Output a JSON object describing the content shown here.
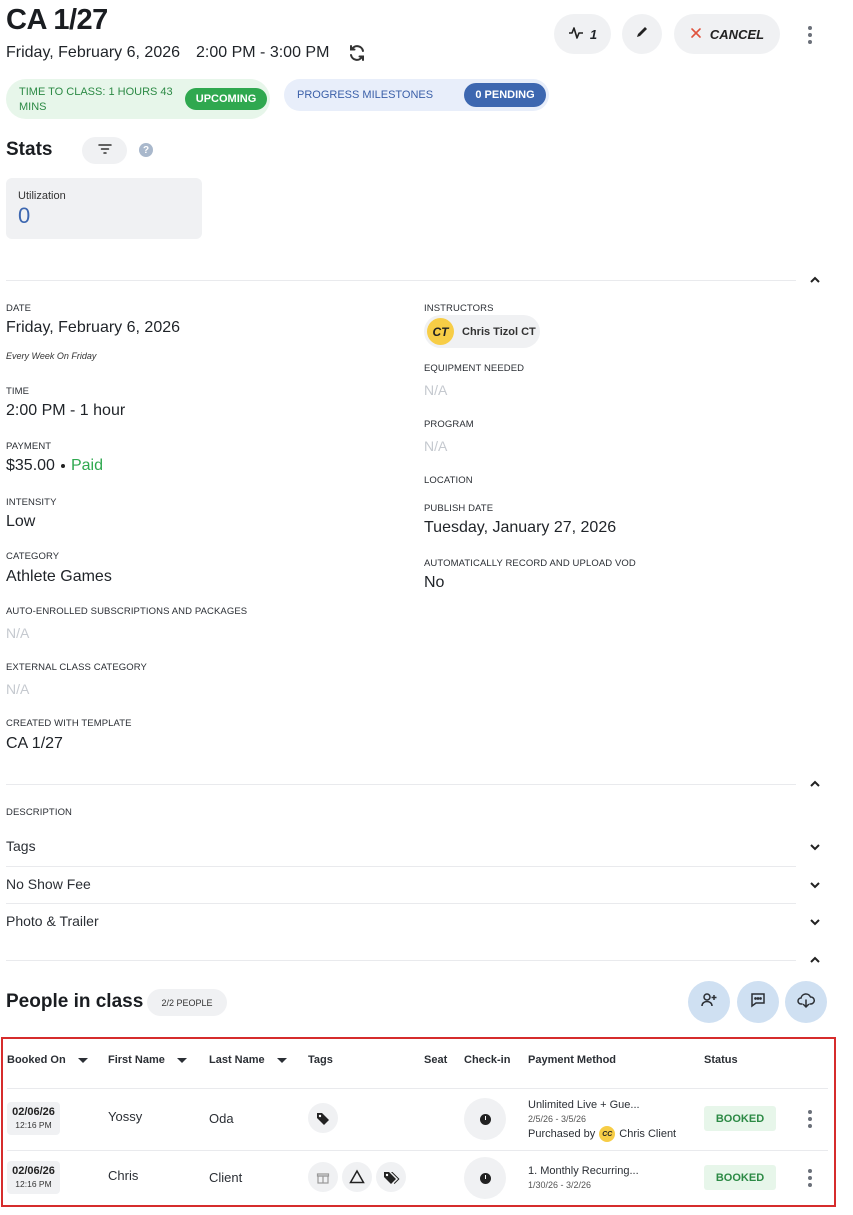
{
  "header": {
    "title": "CA 1/27",
    "date": "Friday, February 6, 2026",
    "time": "2:00 PM - 3:00 PM",
    "activity_count": "1",
    "cancel_label": "CANCEL"
  },
  "status": {
    "time_to_class": "TIME TO CLASS: 1 HOURS 43 MINS",
    "time_badge": "UPCOMING",
    "milestones_label": "PROGRESS MILESTONES",
    "milestones_badge": "0 PENDING"
  },
  "stats": {
    "title": "Stats",
    "help": "?",
    "utilization_label": "Utilization",
    "utilization_value": "0"
  },
  "details": {
    "date_label": "DATE",
    "date_value": "Friday, February 6, 2026",
    "recurrence": "Every Week On Friday",
    "time_label": "TIME",
    "time_value": "2:00 PM - 1 hour",
    "payment_label": "PAYMENT",
    "payment_amount": "$35.00",
    "payment_status": "Paid",
    "intensity_label": "INTENSITY",
    "intensity_value": "Low",
    "category_label": "CATEGORY",
    "category_value": "Athlete Games",
    "auto_enrolled_label": "AUTO-ENROLLED SUBSCRIPTIONS AND PACKAGES",
    "auto_enrolled_value": "N/A",
    "external_category_label": "EXTERNAL CLASS CATEGORY",
    "external_category_value": "N/A",
    "template_label": "CREATED WITH TEMPLATE",
    "template_value": "CA 1/27",
    "instructors_label": "INSTRUCTORS",
    "instructor_initials": "CT",
    "instructor_name": "Chris Tizol CT",
    "equipment_label": "EQUIPMENT NEEDED",
    "equipment_value": "N/A",
    "program_label": "PROGRAM",
    "program_value": "N/A",
    "location_label": "LOCATION",
    "publish_label": "PUBLISH DATE",
    "publish_value": "Tuesday, January 27, 2026",
    "vod_label": "AUTOMATICALLY RECORD AND UPLOAD VOD",
    "vod_value": "No"
  },
  "sections": {
    "description_label": "DESCRIPTION",
    "tags": "Tags",
    "no_show_fee": "No Show Fee",
    "photo_trailer": "Photo & Trailer"
  },
  "people": {
    "title": "People in class",
    "count_badge": "2/2 PEOPLE",
    "columns": [
      "Booked On",
      "First Name",
      "Last Name",
      "Tags",
      "Seat",
      "Check-in",
      "Payment Method",
      "Status"
    ],
    "rows": [
      {
        "date": "02/06/26",
        "time": "12:16 PM",
        "first": "Yossy",
        "last": "Oda",
        "payment_name": "Unlimited Live + Gue...",
        "payment_range": "2/5/26 - 3/5/26",
        "purchased_prefix": "Purchased by",
        "purchaser_initials": "CC",
        "purchaser_name": "Chris Client",
        "status": "BOOKED"
      },
      {
        "date": "02/06/26",
        "time": "12:16 PM",
        "first": "Chris",
        "last": "Client",
        "payment_name": "1. Monthly Recurring...",
        "payment_range": "1/30/26 - 3/2/26",
        "status": "BOOKED"
      }
    ]
  },
  "colors": {
    "green": "#2fa84f",
    "blue": "#3d67b0",
    "cancel_x": "#e0533d",
    "highlight_frame": "#d62c2c"
  }
}
